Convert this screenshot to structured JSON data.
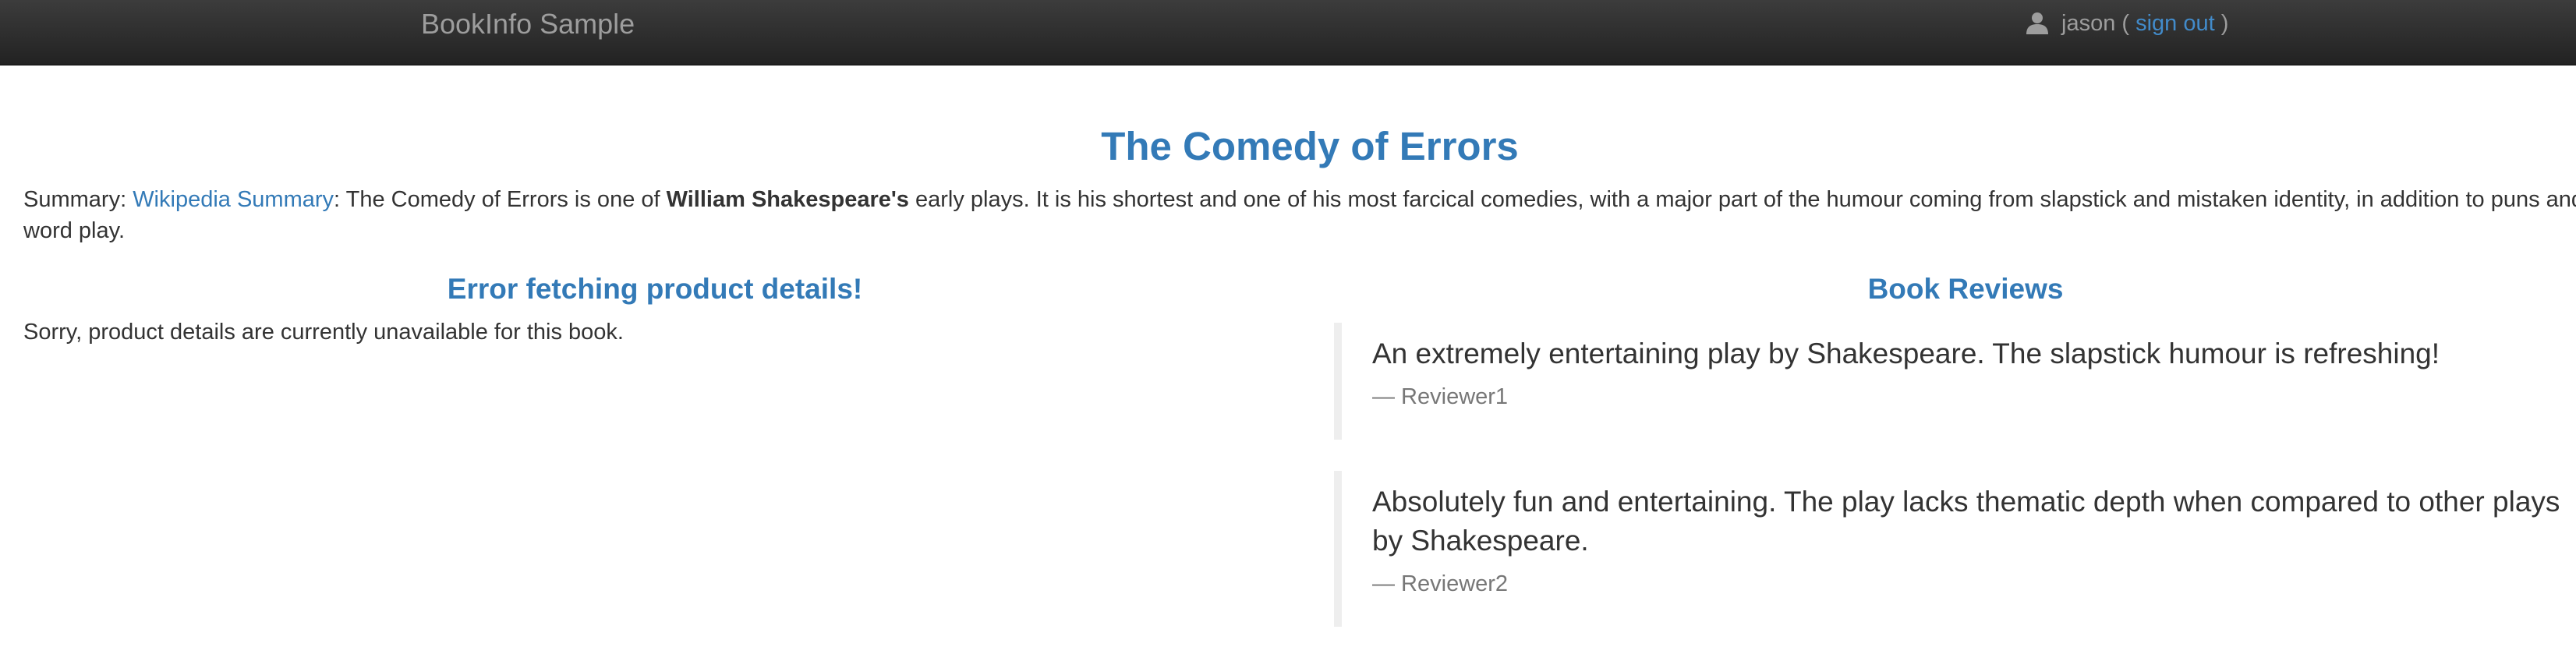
{
  "navbar": {
    "brand": "BookInfo Sample",
    "user_icon": "user-icon",
    "username": "jason",
    "open_paren": " ( ",
    "signout_label": "sign out",
    "close_paren": " )"
  },
  "page": {
    "title": "The Comedy of Errors"
  },
  "summary": {
    "prefix": "Summary: ",
    "link_label": "Wikipedia Summary",
    "text_before_bold": ": The Comedy of Errors is one of ",
    "bold": "William Shakespeare's",
    "text_after_bold": " early plays. It is his shortest and one of his most farcical comedies, with a major part of the humour coming from slapstick and mistaken identity, in addition to puns and word play."
  },
  "details": {
    "heading": "Error fetching product details!",
    "message": "Sorry, product details are currently unavailable for this book."
  },
  "reviews": {
    "heading": "Book Reviews",
    "items": [
      {
        "text": "An extremely entertaining play by Shakespeare. The slapstick humour is refreshing!",
        "author": "— Reviewer1"
      },
      {
        "text": "Absolutely fun and entertaining. The play lacks thematic depth when compared to other plays by Shakespeare.",
        "author": "— Reviewer2"
      }
    ]
  },
  "colors": {
    "navbar_bg": "#222222",
    "brand_text": "#9d9d9d",
    "link": "#337ab7",
    "body_text": "#333333",
    "muted_text": "#777777",
    "blockquote_border": "#eeeeee"
  }
}
